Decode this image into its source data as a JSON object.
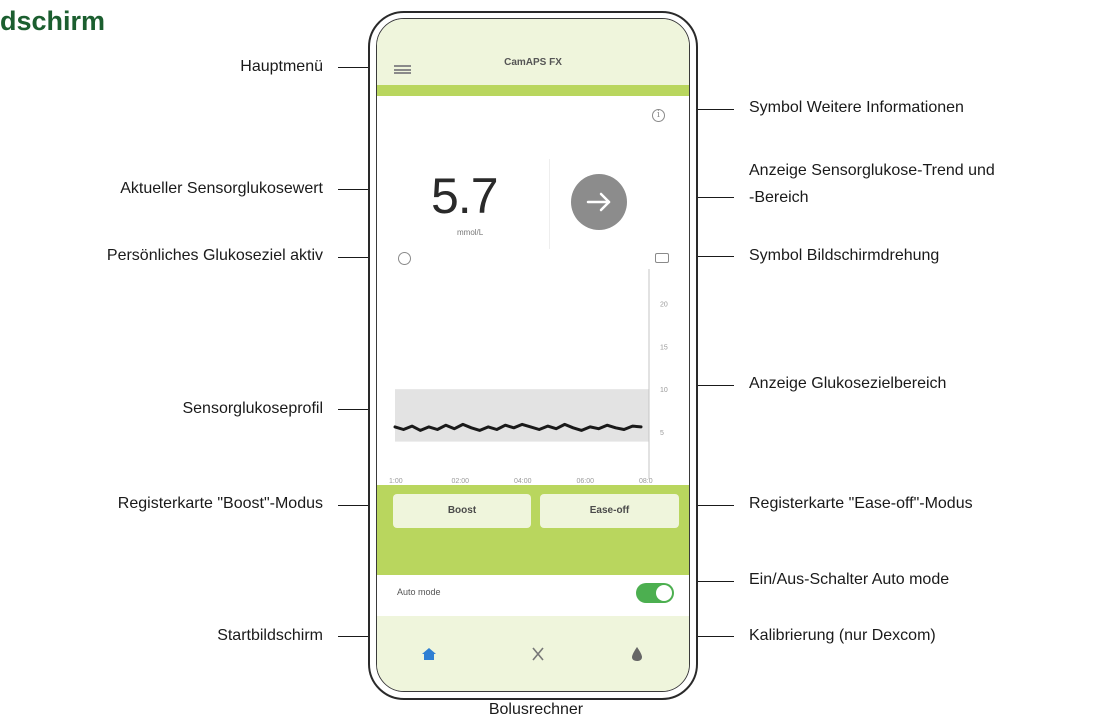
{
  "page": {
    "heading": "dschirm"
  },
  "app": {
    "title": "CamAPS FX",
    "info_icon_glyph": "i",
    "glucose_value": "5.7",
    "glucose_unit": "mmol/L",
    "trend_icon": "arrow-right-icon",
    "mode_buttons": {
      "boost": "Boost",
      "easeoff": "Ease-off"
    },
    "auto_mode_label": "Auto mode",
    "auto_mode_on": true,
    "nav": [
      "home-icon",
      "bolus-calculator-icon",
      "calibration-drop-icon"
    ],
    "colors": {
      "accent_green": "#b9d65e",
      "pale_green": "#eff5dc",
      "toggle_green": "#4caf50",
      "trend_grey": "#8c8c8c",
      "home_blue": "#2f7fd3",
      "heading_green": "#1b5e2f"
    }
  },
  "callouts": {
    "hauptmenu": "Hauptmenü",
    "info": "Symbol Weitere Informationen",
    "current_value": "Aktueller Sensorglukosewert",
    "trend_line1": "Anzeige Sensorglukose-Trend und",
    "trend_line2": "-Bereich",
    "personal_target": "Persönliches Glukoseziel aktiv",
    "rotation": "Symbol Bildschirmdrehung",
    "profile": "Sensorglukoseprofil",
    "target_range": "Anzeige Glukosezielbereich",
    "boost_tab": "Registerkarte \"Boost\"-Modus",
    "easeoff_tab": "Registerkarte \"Ease-off\"-Modus",
    "auto_switch": "Ein/Aus-Schalter Auto mode",
    "home": "Startbildschirm",
    "calibration": "Kalibrierung (nur Dexcom)",
    "bolus": "Bolusrechner"
  },
  "chart_data": {
    "type": "line",
    "y_ticks": [
      "20",
      "15",
      "10",
      "5"
    ],
    "x_ticks": [
      "1:00",
      "02:00",
      "04:00",
      "06:00",
      "08:0"
    ],
    "target_range": [
      3.9,
      10
    ],
    "series": [
      {
        "values": [
          5.6,
          5.3,
          5.7,
          5.2,
          5.6,
          5.3,
          5.8,
          5.4,
          5.9,
          5.5,
          5.2,
          5.6,
          5.3,
          5.8,
          5.5,
          5.9,
          5.6,
          5.3,
          5.7,
          5.4,
          5.9,
          5.5,
          5.2,
          5.6,
          5.4,
          5.8,
          5.5,
          5.3,
          5.7,
          5.6
        ]
      }
    ]
  }
}
